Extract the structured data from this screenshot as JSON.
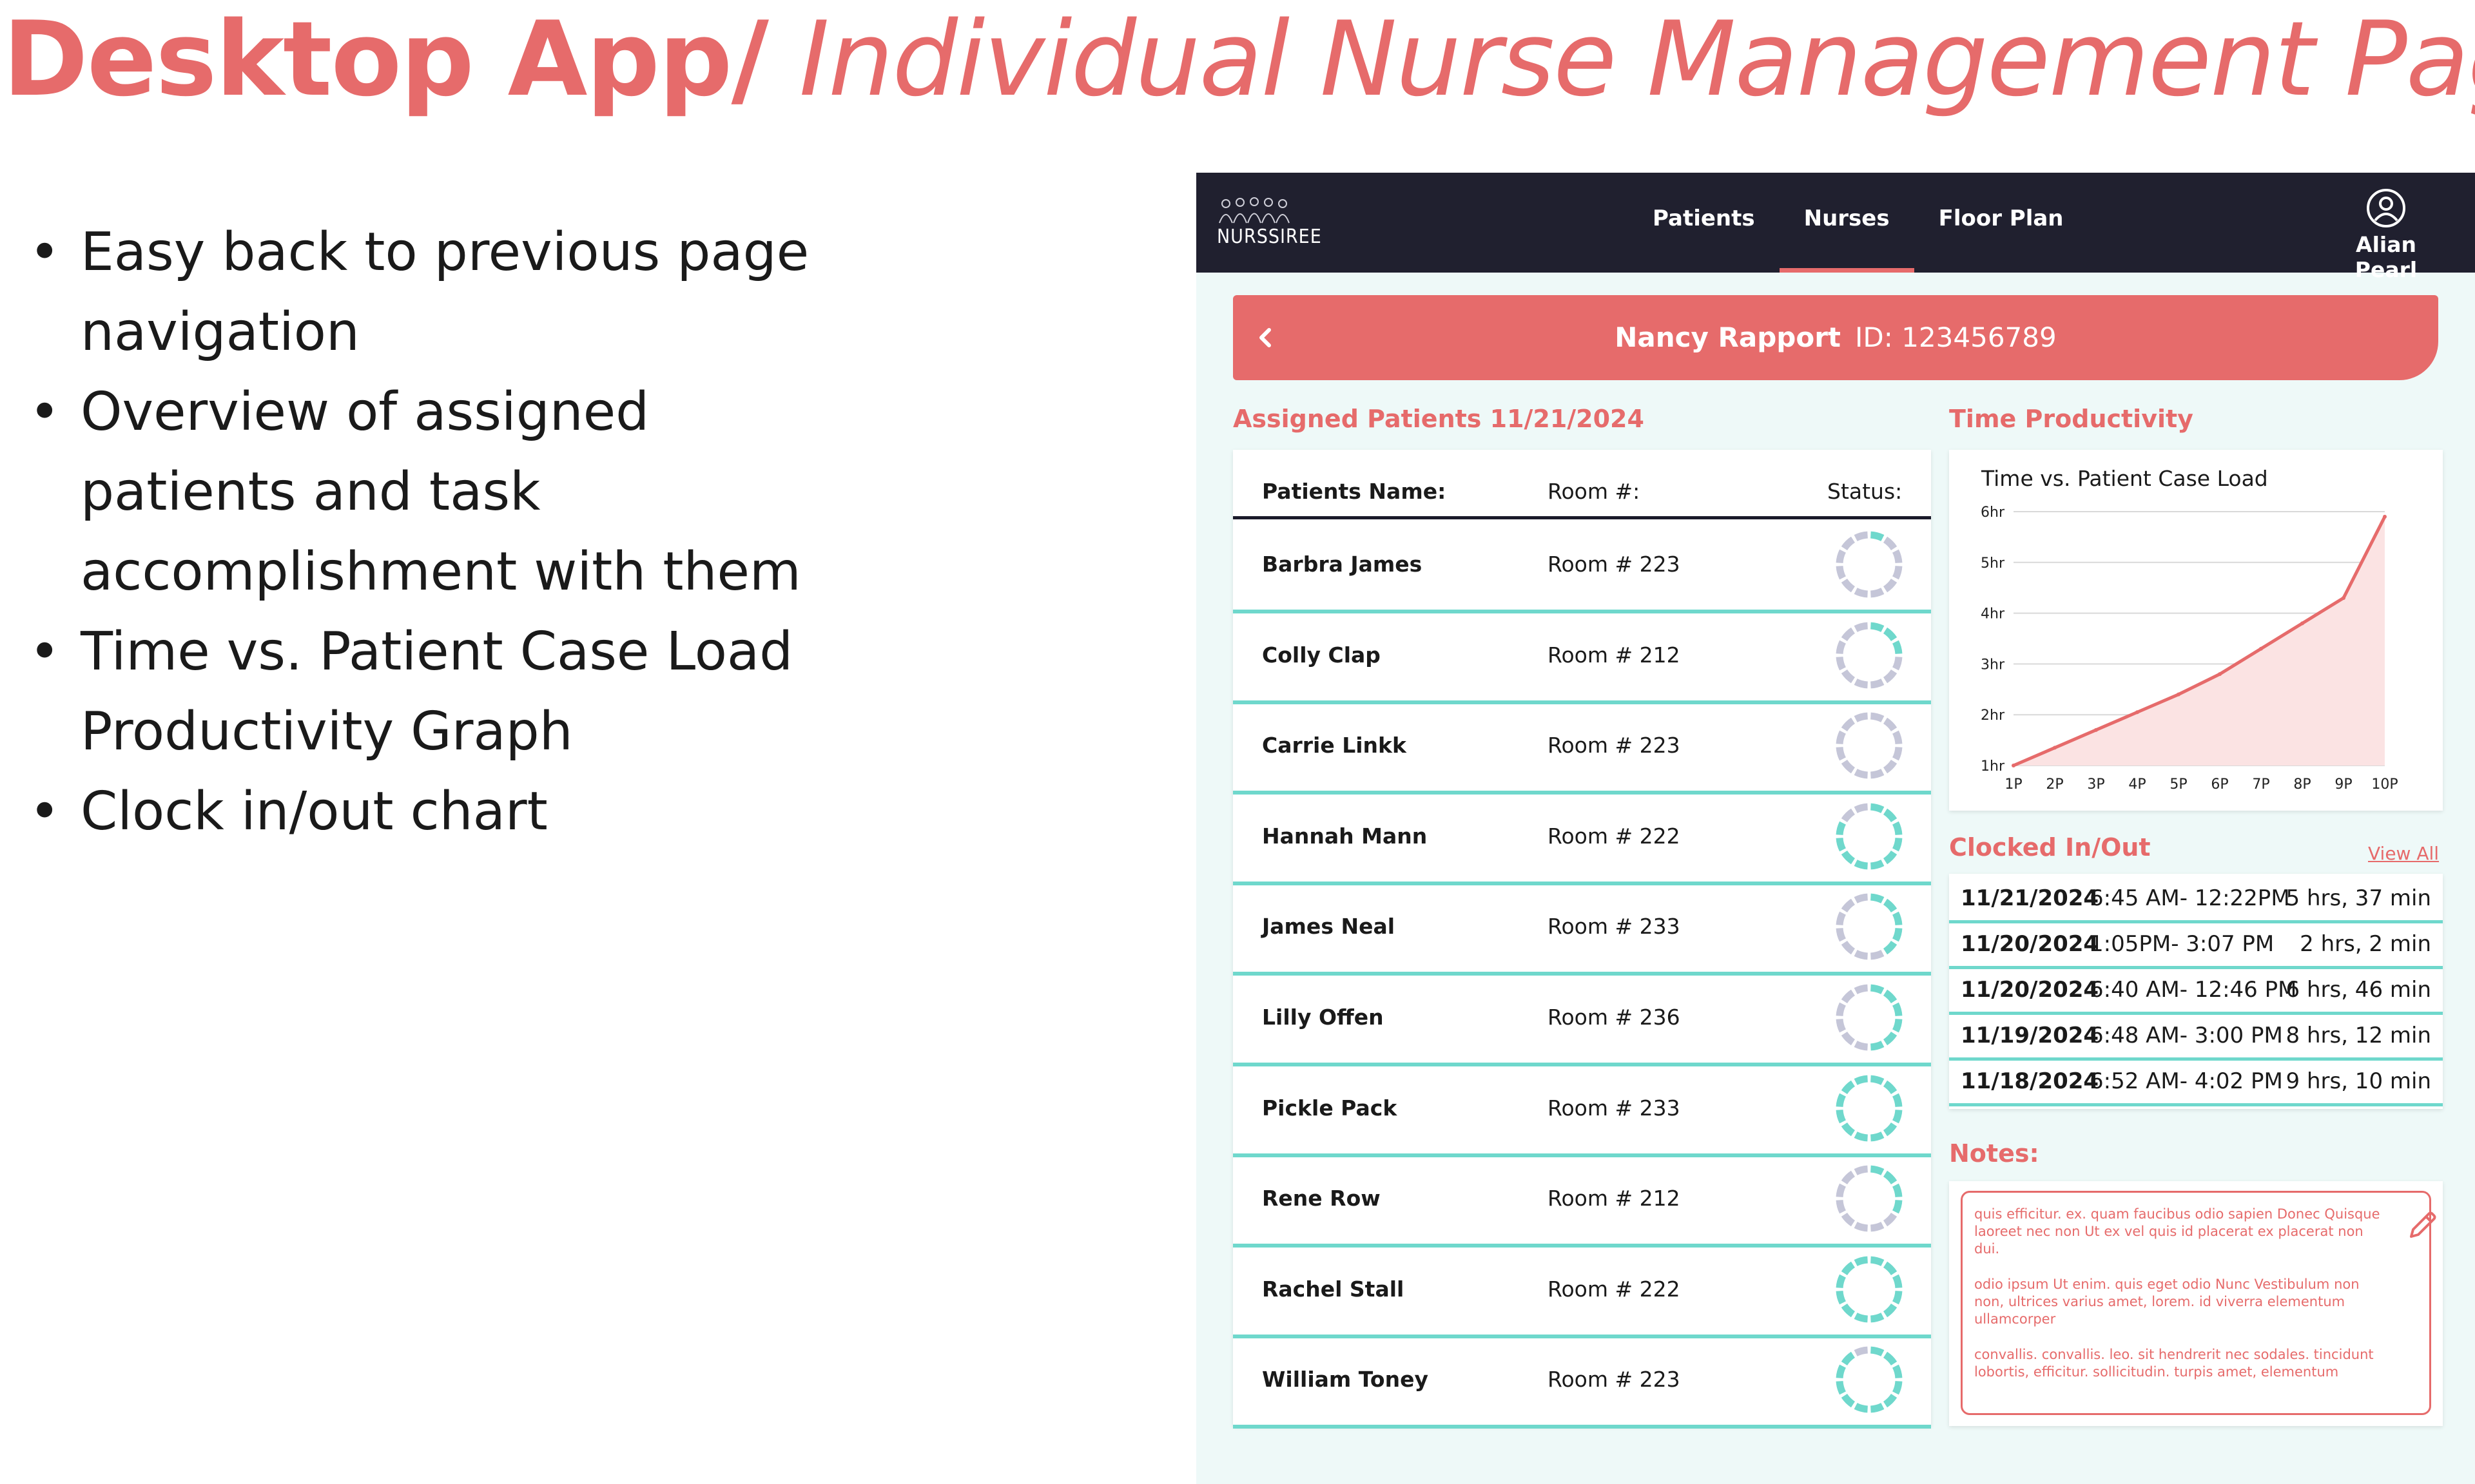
{
  "slide": {
    "title_bold": "Desktop App/",
    "title_italic": " Individual Nurse Management Page",
    "bullets": [
      "Easy back to previous page navigation",
      "Overview of assigned patients and task accomplishment with them",
      "Time vs. Patient Case Load Productivity Graph",
      "Clock in/out chart"
    ],
    "bullet_glyph": "•"
  },
  "nav": {
    "logo_text": "NURSSIREE",
    "tabs": [
      "Patients",
      "Nurses",
      "Floor Plan"
    ],
    "active_tab": "Nurses",
    "user_name": "Alian Pearl",
    "user_icon": "user-circle-icon"
  },
  "banner": {
    "nurse_name": "Nancy Rapport",
    "nurse_id": "ID: 123456789",
    "back_icon": "chevron-left-icon"
  },
  "assigned": {
    "title": "Assigned Patients 11/21/2024",
    "headers": {
      "name": "Patients Name:",
      "room": "Room #:",
      "status": "Status:"
    },
    "patients": [
      {
        "name": "Barbra  James",
        "room": "Room # 223",
        "status": 0.1
      },
      {
        "name": "Colly Clap",
        "room": "Room # 212",
        "status": 0.25
      },
      {
        "name": "Carrie Linkk",
        "room": "Room # 223",
        "status": 0.0
      },
      {
        "name": "Hannah  Mann",
        "room": "Room # 222",
        "status": 0.8
      },
      {
        "name": "James Neal",
        "room": "Room # 233",
        "status": 0.45
      },
      {
        "name": "Lilly Offen",
        "room": "Room # 236",
        "status": 0.5
      },
      {
        "name": "Pickle Pack",
        "room": "Room # 233",
        "status": 1.0
      },
      {
        "name": "Rene Row",
        "room": "Room # 212",
        "status": 0.3
      },
      {
        "name": "Rachel Stall",
        "room": "Room # 222",
        "status": 1.0
      },
      {
        "name": "William Toney",
        "room": "Room # 223",
        "status": 0.95
      }
    ],
    "colors": {
      "done": "#6fd8cc",
      "pending": "#c5c6d8"
    }
  },
  "productivity": {
    "title": "Time Productivity",
    "chart_data": {
      "type": "area",
      "title": "Time vs. Patient Case Load",
      "x": [
        "1P",
        "2P",
        "3P",
        "4P",
        "5P",
        "6P",
        "7P",
        "8P",
        "9P",
        "10P"
      ],
      "values": [
        1.0,
        1.35,
        1.7,
        2.05,
        2.4,
        2.8,
        3.3,
        3.8,
        4.3,
        5.9
      ],
      "yticks": [
        "1hr",
        "2hr",
        "3hr",
        "4hr",
        "5hr",
        "6hr"
      ],
      "ylim": [
        1,
        6
      ],
      "grid": true,
      "line_color": "#e66b6b",
      "fill_color": "#fbe3e3"
    }
  },
  "clocked": {
    "title": "Clocked In/Out",
    "view_all": "View All",
    "rows": [
      {
        "date": "11/21/2024",
        "time": "6:45 AM- 12:22PM",
        "duration": "5 hrs, 37 min"
      },
      {
        "date": "11/20/2024",
        "time": "1:05PM- 3:07 PM",
        "duration": "2 hrs, 2 min"
      },
      {
        "date": "11/20/2024",
        "time": "6:40 AM- 12:46 PM",
        "duration": "6 hrs, 46 min"
      },
      {
        "date": "11/19/2024",
        "time": "6:48 AM- 3:00 PM",
        "duration": "8 hrs, 12 min"
      },
      {
        "date": "11/18/2024",
        "time": "6:52 AM- 4:02 PM",
        "duration": "9 hrs, 10 min"
      }
    ]
  },
  "notes": {
    "title": "Notes:",
    "edit_icon": "pencil-icon",
    "paragraphs": [
      "quis efficitur. ex. quam faucibus odio sapien Donec Quisque laoreet nec non Ut ex vel quis id placerat ex placerat non dui.",
      "odio ipsum Ut enim. quis eget odio Nunc Vestibulum non non, ultrices varius amet, lorem. id viverra elementum ullamcorper",
      "convallis. convallis. leo. sit hendrerit nec sodales. tincidunt lobortis, efficitur. sollicitudin. turpis amet, elementum"
    ]
  }
}
